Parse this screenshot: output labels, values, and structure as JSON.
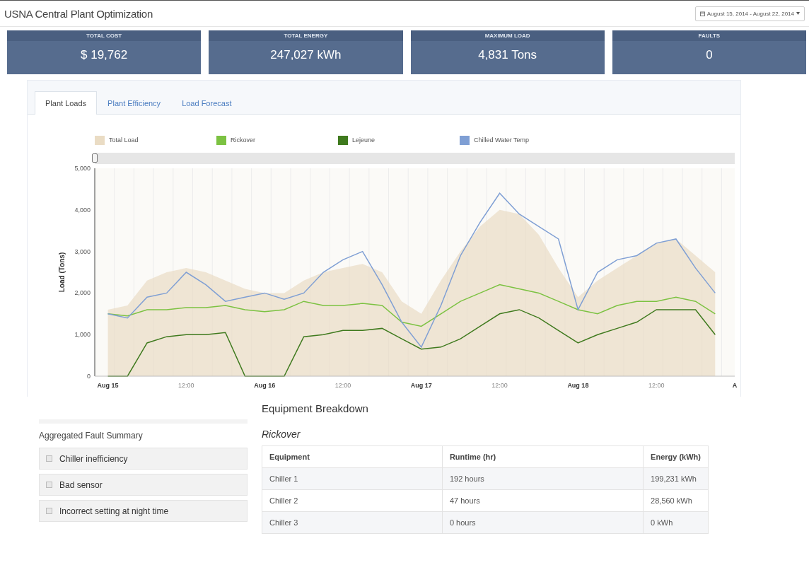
{
  "header": {
    "title": "USNA Central Plant Optimization",
    "date_range": "August 15, 2014 - August 22, 2014"
  },
  "kpis": [
    {
      "label": "TOTAL COST",
      "value": "$ 19,762"
    },
    {
      "label": "TOTAL ENERGY",
      "value": "247,027 kWh"
    },
    {
      "label": "MAXIMUM LOAD",
      "value": "4,831 Tons"
    },
    {
      "label": "FAULTS",
      "value": "0"
    }
  ],
  "tabs": [
    {
      "label": "Plant Loads",
      "selected": true
    },
    {
      "label": "Plant Efficiency",
      "selected": false
    },
    {
      "label": "Load Forecast",
      "selected": false
    }
  ],
  "chart_data": {
    "type": "line",
    "legend": "top",
    "ylabel": "Load (Tons)",
    "ylim": [
      0,
      5000
    ],
    "categories": [
      "Aug 15",
      null,
      null,
      null,
      "12:00",
      null,
      null,
      null,
      "Aug 16",
      null,
      null,
      null,
      "12:00",
      null,
      null,
      null,
      "Aug 17",
      null,
      null,
      null,
      "12:00",
      null,
      null,
      null,
      "Aug 18",
      null,
      null,
      null,
      "12:00",
      null,
      null,
      null,
      "A"
    ],
    "yticks": [
      0,
      {
        "value": 1000,
        "label": "1,000"
      },
      {
        "value": 2000,
        "label": "2,000"
      },
      {
        "value": 3000,
        "label": "3,000"
      },
      {
        "value": 4000,
        "label": "4,000"
      },
      {
        "value": 5000,
        "label": "5,000"
      }
    ],
    "series": [
      {
        "name": "Total Load",
        "color": "#eadcc4",
        "type": "area",
        "values": [
          1600,
          1700,
          2300,
          2500,
          2600,
          2500,
          2300,
          2100,
          2000,
          2000,
          2300,
          2500,
          2600,
          2700,
          2500,
          1800,
          1500,
          2300,
          3000,
          3600,
          4000,
          3900,
          3400,
          2600,
          1900,
          2300,
          2600,
          2900,
          3200,
          3300,
          2900,
          2500,
          null
        ]
      },
      {
        "name": "Rickover",
        "color": "#7cc242",
        "values": [
          1500,
          1450,
          1600,
          1600,
          1650,
          1650,
          1700,
          1600,
          1550,
          1600,
          1800,
          1700,
          1700,
          1750,
          1700,
          1300,
          1200,
          1500,
          1800,
          2000,
          2200,
          2100,
          2000,
          1800,
          1600,
          1500,
          1700,
          1800,
          1800,
          1900,
          1800,
          1500,
          null
        ]
      },
      {
        "name": "Lejeune",
        "color": "#3f7a1e",
        "values": [
          0,
          0,
          800,
          950,
          1000,
          1000,
          1050,
          0,
          0,
          0,
          950,
          1000,
          1100,
          1100,
          1150,
          900,
          650,
          700,
          900,
          1200,
          1500,
          1600,
          1400,
          1100,
          800,
          1000,
          1150,
          1300,
          1600,
          1600,
          1600,
          1000,
          null
        ]
      },
      {
        "name": "Chilled Water Temp",
        "color": "#7f9fd4",
        "values": [
          1500,
          1400,
          1900,
          2000,
          2500,
          2200,
          1800,
          1900,
          2000,
          1850,
          2000,
          2500,
          2800,
          3000,
          2200,
          1300,
          700,
          1700,
          2900,
          3700,
          4400,
          3900,
          3600,
          3300,
          1600,
          2500,
          2800,
          2900,
          3200,
          3300,
          2600,
          2000,
          null
        ]
      }
    ]
  },
  "faults": {
    "title": "Aggregated Fault Summary",
    "items": [
      {
        "label": "Chiller inefficiency",
        "checked": false
      },
      {
        "label": "Bad sensor",
        "checked": false
      },
      {
        "label": "Incorrect setting at night time",
        "checked": false
      }
    ]
  },
  "equipment": {
    "title": "Equipment Breakdown",
    "plant": "Rickover",
    "columns": [
      "Equipment",
      "Runtime (hr)",
      "Energy (kWh)"
    ],
    "rows": [
      [
        "Chiller 1",
        "192 hours",
        "199,231 kWh"
      ],
      [
        "Chiller 2",
        "47 hours",
        "28,560 kWh"
      ],
      [
        "Chiller 3",
        "0 hours",
        "0 kWh"
      ]
    ]
  }
}
